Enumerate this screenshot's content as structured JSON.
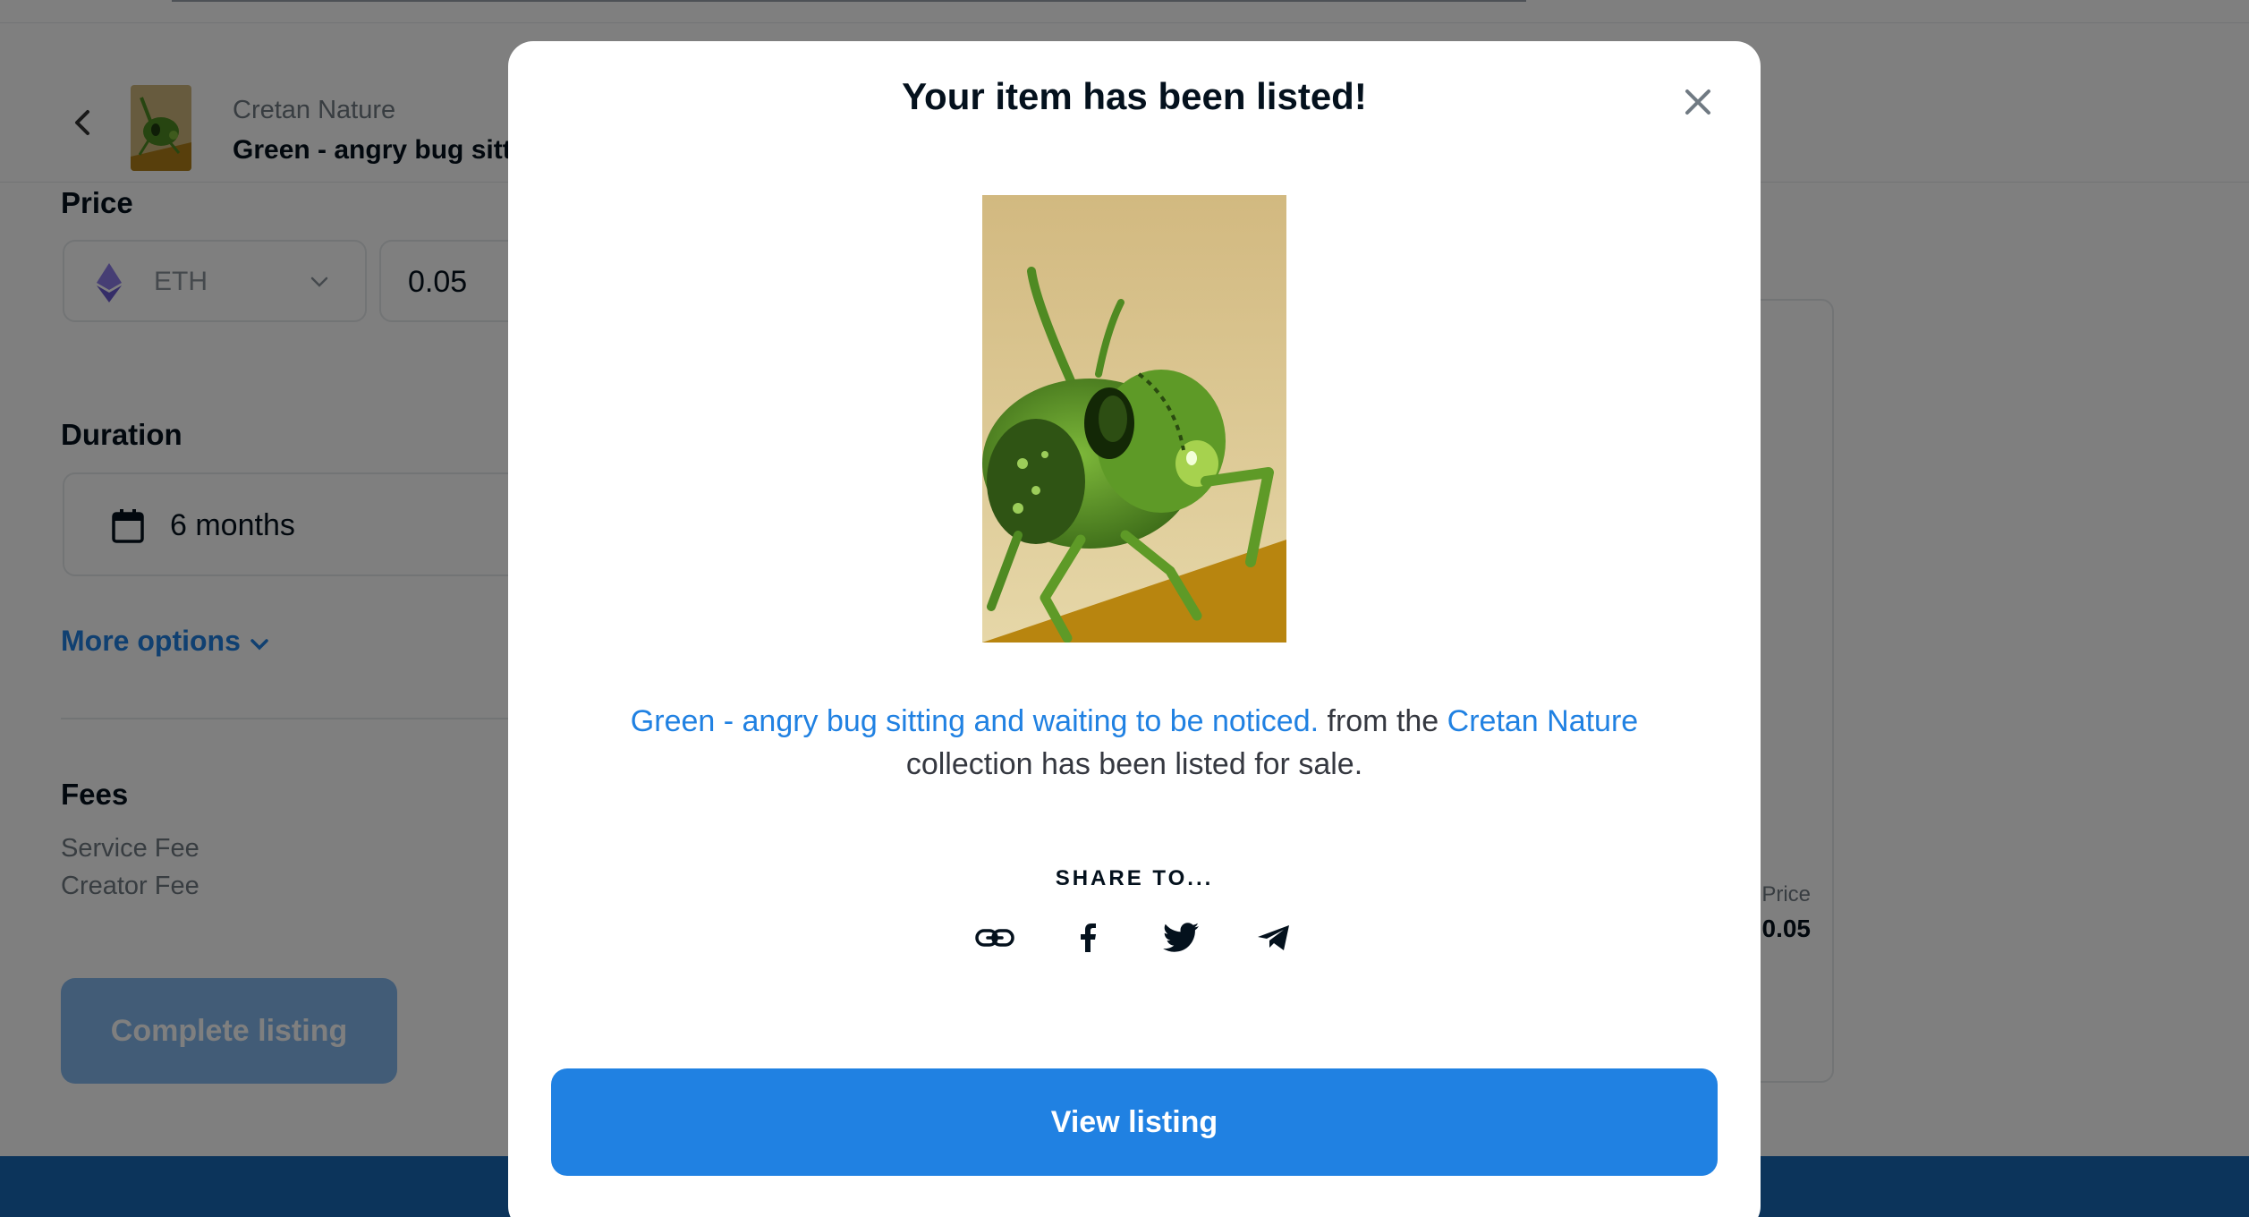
{
  "background_page": {
    "header": {
      "collection": "Cretan Nature",
      "item_name": "Green - angry bug sitt"
    },
    "price": {
      "label": "Price",
      "currency": "ETH",
      "amount": "0.05"
    },
    "duration": {
      "label": "Duration",
      "value": "6 months"
    },
    "more_options_label": "More options",
    "fees": {
      "label": "Fees",
      "service_fee_label": "Service Fee",
      "creator_fee_label": "Creator Fee"
    },
    "complete_button_label": "Complete listing",
    "preview": {
      "price_label": "Price",
      "price_value": "0.05"
    }
  },
  "modal": {
    "title": "Your item has been listed!",
    "item_link_text": "Green - angry bug sitting and waiting to be noticed.",
    "message_mid": " from the ",
    "collection_link_text": "Cretan Nature",
    "message_end": "collection has been listed for sale.",
    "share_title": "SHARE TO...",
    "share_icons": [
      "link-icon",
      "facebook-icon",
      "twitter-icon",
      "telegram-icon"
    ],
    "view_button_label": "View listing"
  },
  "colors": {
    "accent": "#2081e2",
    "text_dark": "#04111d",
    "text_muted": "#707a83",
    "overlay": "rgba(0,0,0,0.5)"
  }
}
